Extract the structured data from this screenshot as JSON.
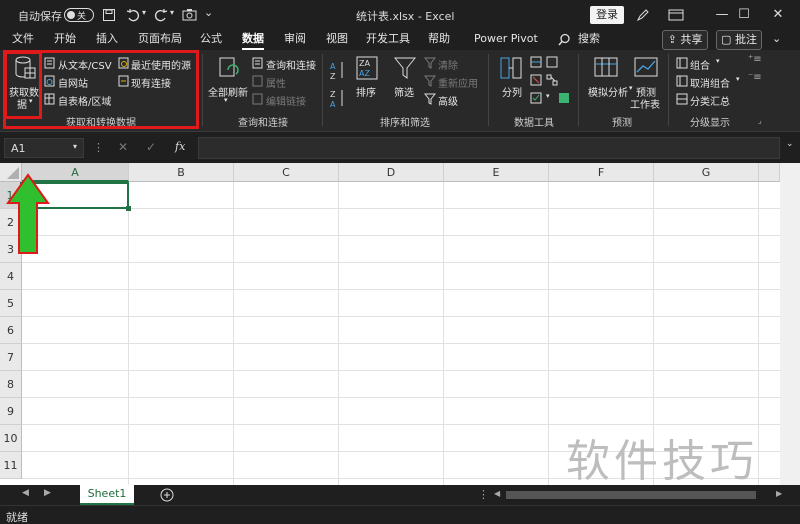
{
  "titlebar": {
    "autosave_label": "自动保存",
    "autosave_state": "关",
    "filename": "统计表.xlsx",
    "separator": "-",
    "app_name": "Excel",
    "login_label": "登录"
  },
  "tabs": [
    "文件",
    "开始",
    "插入",
    "页面布局",
    "公式",
    "数据",
    "审阅",
    "视图",
    "开发工具",
    "帮助",
    "Power Pivot"
  ],
  "active_tab": "数据",
  "search_label": "搜索",
  "share_label": "共享",
  "comments_label": "批注",
  "ribbon": {
    "get_data": {
      "big_button_line1": "获取数",
      "big_button_line2": "据",
      "from_text_csv": "从文本/CSV",
      "from_web": "自网站",
      "from_table": "自表格/区域",
      "recent_sources": "最近使用的源",
      "existing_connections": "现有连接",
      "group_label": "获取和转换数据"
    },
    "queries": {
      "refresh_all": "全部刷新",
      "queries_connections": "查询和连接",
      "properties": "属性",
      "edit_links": "编辑链接",
      "group_label": "查询和连接"
    },
    "sort_filter": {
      "sort": "排序",
      "filter": "筛选",
      "clear": "清除",
      "reapply": "重新应用",
      "advanced": "高级",
      "group_label": "排序和筛选"
    },
    "data_tools": {
      "split": "分列",
      "group_label": "数据工具"
    },
    "forecast": {
      "what_if": "模拟分析",
      "forecast_sheet_line1": "预测",
      "forecast_sheet_line2": "工作表",
      "group_label": "预测"
    },
    "outline": {
      "group": "组合",
      "ungroup": "取消组合",
      "subtotal": "分类汇总",
      "group_label": "分级显示"
    }
  },
  "formula_bar": {
    "name_box": "A1",
    "fx": "fx",
    "value": ""
  },
  "columns": [
    "A",
    "B",
    "C",
    "D",
    "E",
    "F",
    "G"
  ],
  "rows": [
    "1",
    "2",
    "3",
    "4",
    "5",
    "6",
    "7",
    "8",
    "9",
    "10",
    "11"
  ],
  "selected_cell": "A1",
  "sheet_tabs": [
    "Sheet1"
  ],
  "status": "就绪",
  "watermark": "软件技巧",
  "colors": {
    "accent": "#217346",
    "highlight_box": "#e01a1a",
    "arrow": "#2fbf2f"
  }
}
